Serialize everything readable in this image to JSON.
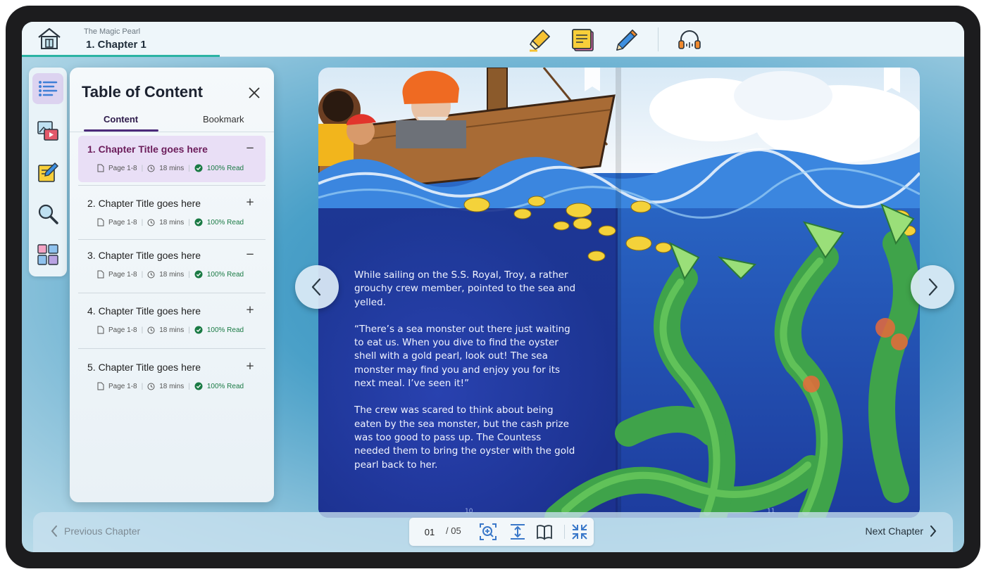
{
  "header": {
    "book_title": "The Magic Pearl",
    "chapter_title": "1. Chapter 1",
    "tools": [
      "highlighter-icon",
      "notes-icon",
      "pen-icon",
      "headphones-icon"
    ],
    "progress": 0.21
  },
  "sidebar": {
    "items": [
      "contents-list-icon",
      "media-icon",
      "edit-notes-icon",
      "search-icon",
      "layout-grid-icon"
    ],
    "active_index": 0
  },
  "toc": {
    "title": "Table of Content",
    "tabs": {
      "content": "Content",
      "bookmark": "Bookmark"
    },
    "chapters": [
      {
        "title": "1. Chapter Title goes here",
        "toggle": "−",
        "pages": "Page 1-8",
        "time": "18 mins",
        "status": "100% Read",
        "active": true
      },
      {
        "title": "2. Chapter Title goes here",
        "toggle": "+",
        "pages": "Page 1-8",
        "time": "18 mins",
        "status": "100% Read"
      },
      {
        "title": "3. Chapter Title goes here",
        "toggle": "−",
        "pages": "Page 1-8",
        "time": "18 mins",
        "status": "100% Read"
      },
      {
        "title": "4. Chapter Title goes here",
        "toggle": "+",
        "pages": "Page 1-8",
        "time": "18 mins",
        "status": "100% Read"
      },
      {
        "title": "5. Chapter Title goes here",
        "toggle": "+",
        "pages": "Page 1-8",
        "time": "18 mins",
        "status": "100% Read"
      }
    ]
  },
  "book": {
    "paragraphs": [
      "While sailing on the S.S. Royal, Troy, a rather grouchy crew member, pointed to the sea and yelled.",
      "“There’s a sea monster out there just waiting to eat us. When you dive to find the oyster shell with a gold pearl, look out! The sea monster may find you and enjoy you for its next meal. I’ve seen it!”",
      "The crew was scared to think about being eaten by the sea monster, but the cash prize was too good to pass up. The Countess needed them to bring the oyster with the gold pearl back to her."
    ],
    "left_page_number": "10",
    "right_page_number": "11"
  },
  "footer": {
    "previous": "Previous Chapter",
    "next": "Next Chapter",
    "page_current": "01",
    "page_total": "/ 05",
    "tools": [
      "zoom-in-icon",
      "fit-height-icon",
      "book-view-icon",
      "exit-fullscreen-icon"
    ]
  },
  "colors": {
    "accent": "#2bb3a3",
    "active_chapter_bg": "#e9dff6",
    "active_chapter_text": "#6c1d5b",
    "read_status": "#1a7a44",
    "tab_active": "#4b2a7a"
  }
}
